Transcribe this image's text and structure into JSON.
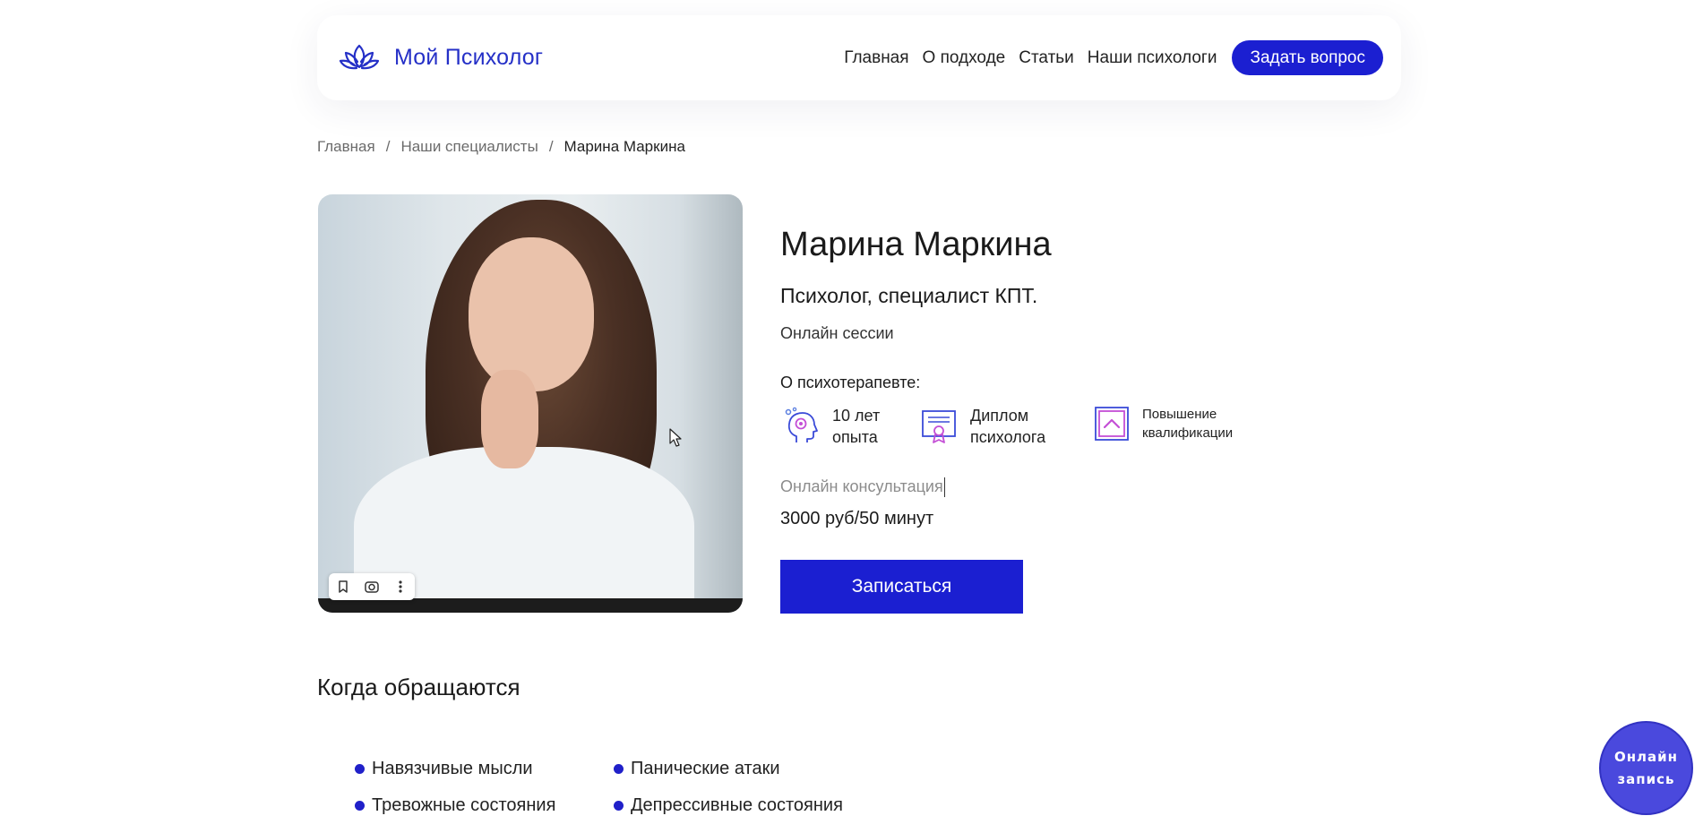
{
  "header": {
    "logo_text": "Мой Психолог",
    "nav": [
      "Главная",
      "О подходе",
      "Статьи",
      "Наши психологи"
    ],
    "cta_label": "Задать вопрос"
  },
  "breadcrumb": {
    "items": [
      "Главная",
      "Наши специалисты"
    ],
    "separator": "/",
    "current": "Марина Маркина"
  },
  "profile": {
    "name": "Марина Маркина",
    "role": "Психолог, специалист КПТ.",
    "format": "Онлайн сессии",
    "about_heading": "О психотерапевте:",
    "features": [
      {
        "icon": "head-brain-icon",
        "line1": "10 лет",
        "line2": "опыта"
      },
      {
        "icon": "diploma-certificate-icon",
        "line1": "Диплом",
        "line2": "психолога"
      },
      {
        "icon": "qualification-upgrade-icon",
        "line1": "Повышение",
        "line2": "квалификации"
      }
    ],
    "consult_label": "Онлайн консультация",
    "price": "3000 руб/50 минут",
    "book_label": "Записаться"
  },
  "image_toolbar": [
    "bookmark-icon",
    "lens-search-icon",
    "more-vertical-icon"
  ],
  "when": {
    "heading": "Когда обращаются",
    "items": [
      "Навязчивые мысли",
      "Панические атаки",
      "Тревожные состояния",
      "Депрессивные состояния"
    ]
  },
  "floating": {
    "line1": "Онлайн",
    "line2": "запись"
  },
  "colors": {
    "accent": "#1b1fd1",
    "bullet": "#2020c9",
    "floating": "#4a49dd"
  }
}
